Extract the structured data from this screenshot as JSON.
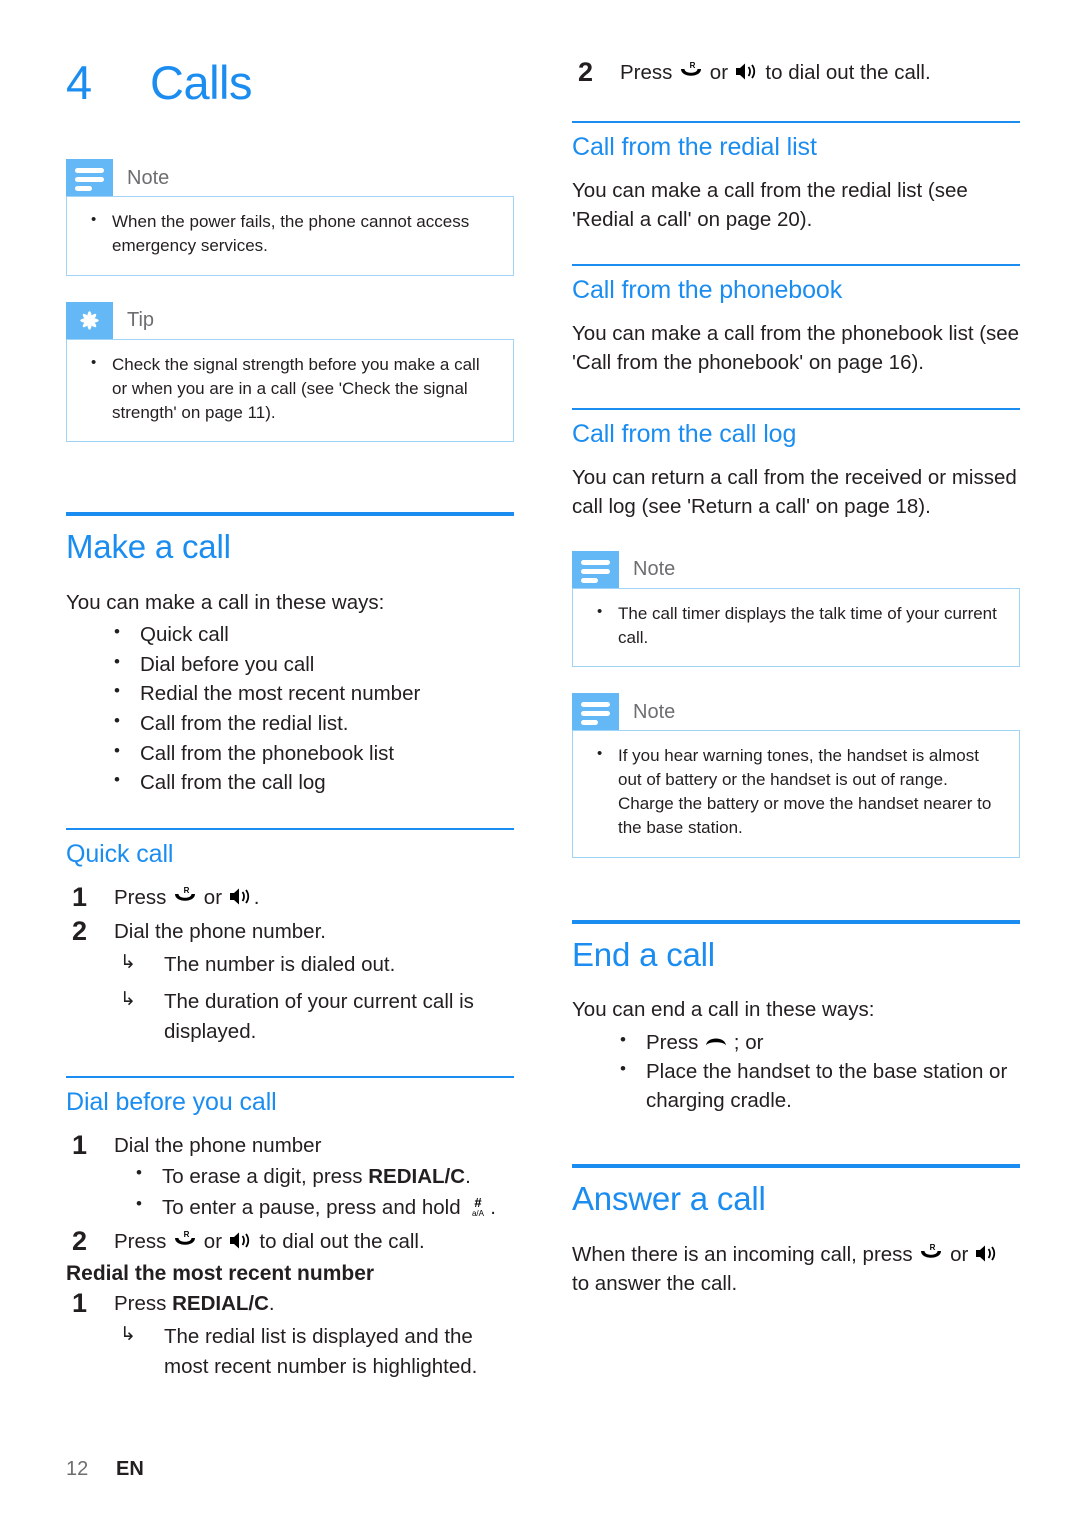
{
  "page": {
    "chapter_number": "4",
    "chapter_title": "Calls",
    "footer_page": "12",
    "footer_lang": "EN",
    "accent_color": "#1b8df0",
    "callout_badge_color": "#63b8f5",
    "callout_border_color": "#9fd4f7"
  },
  "left": {
    "note1": {
      "label": "Note",
      "icon": "note-lines-icon",
      "items": [
        "When the power fails, the phone cannot access emergency services."
      ]
    },
    "tip1": {
      "label": "Tip",
      "icon": "tip-asterisk-icon",
      "items": [
        "Check the signal strength before you make a call or when you are in a call (see 'Check the signal strength' on page 11)."
      ]
    },
    "make_a_call": {
      "heading": "Make a call",
      "intro": "You can make a call in these ways:",
      "ways": [
        "Quick call",
        "Dial before you call",
        "Redial the most recent number",
        "Call from the redial list.",
        "Call from the phonebook list",
        "Call from the call log"
      ]
    },
    "quick_call": {
      "heading": "Quick call",
      "step1_num": "1",
      "step1_text_pre": "Press ",
      "step1_icon_a": "talk-handset-icon",
      "step1_text_mid": " or ",
      "step1_icon_b": "speakerphone-icon",
      "step1_text_post": ".",
      "step2_num": "2",
      "step2_text": "Dial the phone number.",
      "results": [
        "The number is dialed out.",
        "The duration of your current call is displayed."
      ]
    },
    "dial_before": {
      "heading": "Dial before you call",
      "step1_num": "1",
      "step1_text": "Dial the phone number",
      "sub1_pre": "To erase a digit, press ",
      "sub1_key": "REDIAL/C",
      "sub1_post": ".",
      "sub2_pre": "To enter a pause, press and hold ",
      "sub2_icon": "hash-aA-key-icon",
      "sub2_post": ".",
      "step2_num": "2",
      "step2_pre": "Press ",
      "step2_icon_a": "talk-handset-icon",
      "step2_mid": " or ",
      "step2_icon_b": "speakerphone-icon",
      "step2_post": " to dial out the call."
    },
    "redial_recent": {
      "heading": "Redial the most recent number",
      "step1_num": "1",
      "step1_pre": "Press ",
      "step1_key": "REDIAL/C",
      "step1_post": ".",
      "results": [
        "The redial list is displayed and the most recent number is highlighted."
      ]
    }
  },
  "right": {
    "top_step": {
      "num": "2",
      "pre": "Press ",
      "icon_a": "talk-handset-icon",
      "mid": " or ",
      "icon_b": "speakerphone-icon",
      "post": " to dial out the call."
    },
    "redial_list": {
      "heading": "Call from the redial list",
      "body": "You can make a call from the redial list (see 'Redial a call' on page 20)."
    },
    "phonebook": {
      "heading": "Call from the phonebook",
      "body": "You can make a call from the phonebook list (see 'Call from the phonebook' on page 16)."
    },
    "call_log": {
      "heading": "Call from the call log",
      "body": "You can return a call from the received or missed call log (see 'Return a call' on page 18)."
    },
    "note2": {
      "label": "Note",
      "icon": "note-lines-icon",
      "items": [
        "The call timer displays the talk time of your current call."
      ]
    },
    "note3": {
      "label": "Note",
      "icon": "note-lines-icon",
      "items": [
        "If you hear warning tones, the handset is almost out of battery or the handset is out of range. Charge the battery or move the handset nearer to the base station."
      ]
    },
    "end_a_call": {
      "heading": "End a call",
      "intro": "You can end a call in these ways:",
      "way1_pre": "Press ",
      "way1_icon": "hangup-icon",
      "way1_post": " ; or",
      "way2": "Place the handset to the base station or charging cradle."
    },
    "answer_a_call": {
      "heading": "Answer a call",
      "pre": "When there is an incoming call,  press ",
      "icon_a": "talk-handset-icon",
      "mid": " or ",
      "icon_b": "speakerphone-icon",
      "post": " to answer the call."
    }
  }
}
